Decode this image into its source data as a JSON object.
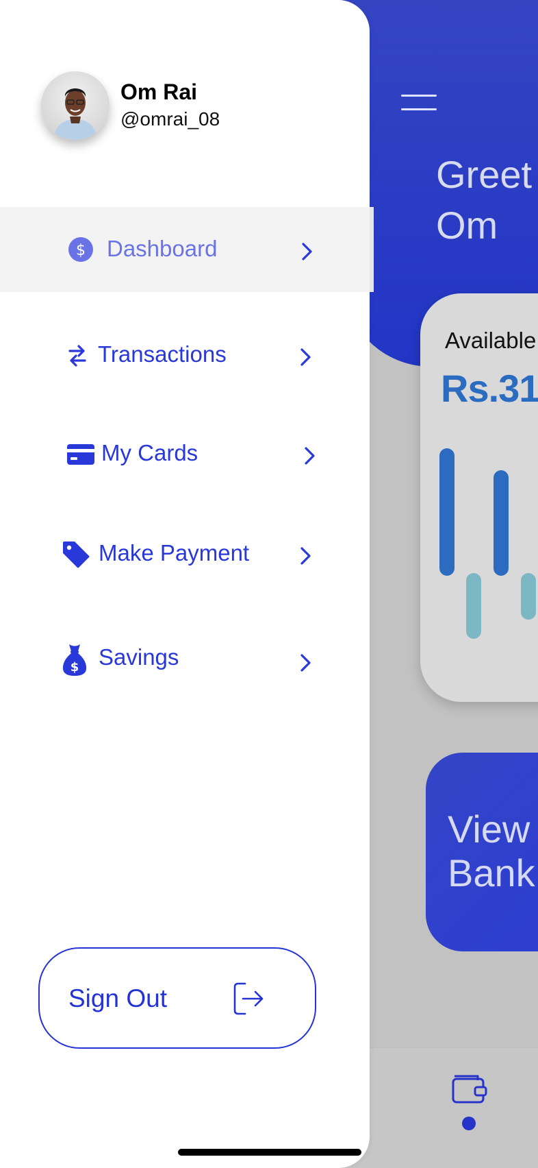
{
  "profile": {
    "name": "Om Rai",
    "handle": "@omrai_08"
  },
  "menu": {
    "items": [
      {
        "label": "Dashboard",
        "icon": "dollar-coin-icon",
        "active": true
      },
      {
        "label": "Transactions",
        "icon": "swap-arrows-icon",
        "active": false
      },
      {
        "label": "My Cards",
        "icon": "credit-card-icon",
        "active": false
      },
      {
        "label": "Make Payment",
        "icon": "price-tag-icon",
        "active": false
      },
      {
        "label": "Savings",
        "icon": "money-bag-icon",
        "active": false
      }
    ]
  },
  "signout": {
    "label": "Sign Out",
    "icon": "sign-out-icon"
  },
  "background": {
    "greeting": "Greet\nOm",
    "balance_label": "Available",
    "balance_value": "Rs.31",
    "view_text": "View\nBank"
  },
  "colors": {
    "accent": "#2938d8",
    "active_label": "#6a73e6",
    "header_blue": "#2235c6",
    "balance_blue": "#2c6cc0",
    "bar_teal": "#7cb7c4"
  }
}
